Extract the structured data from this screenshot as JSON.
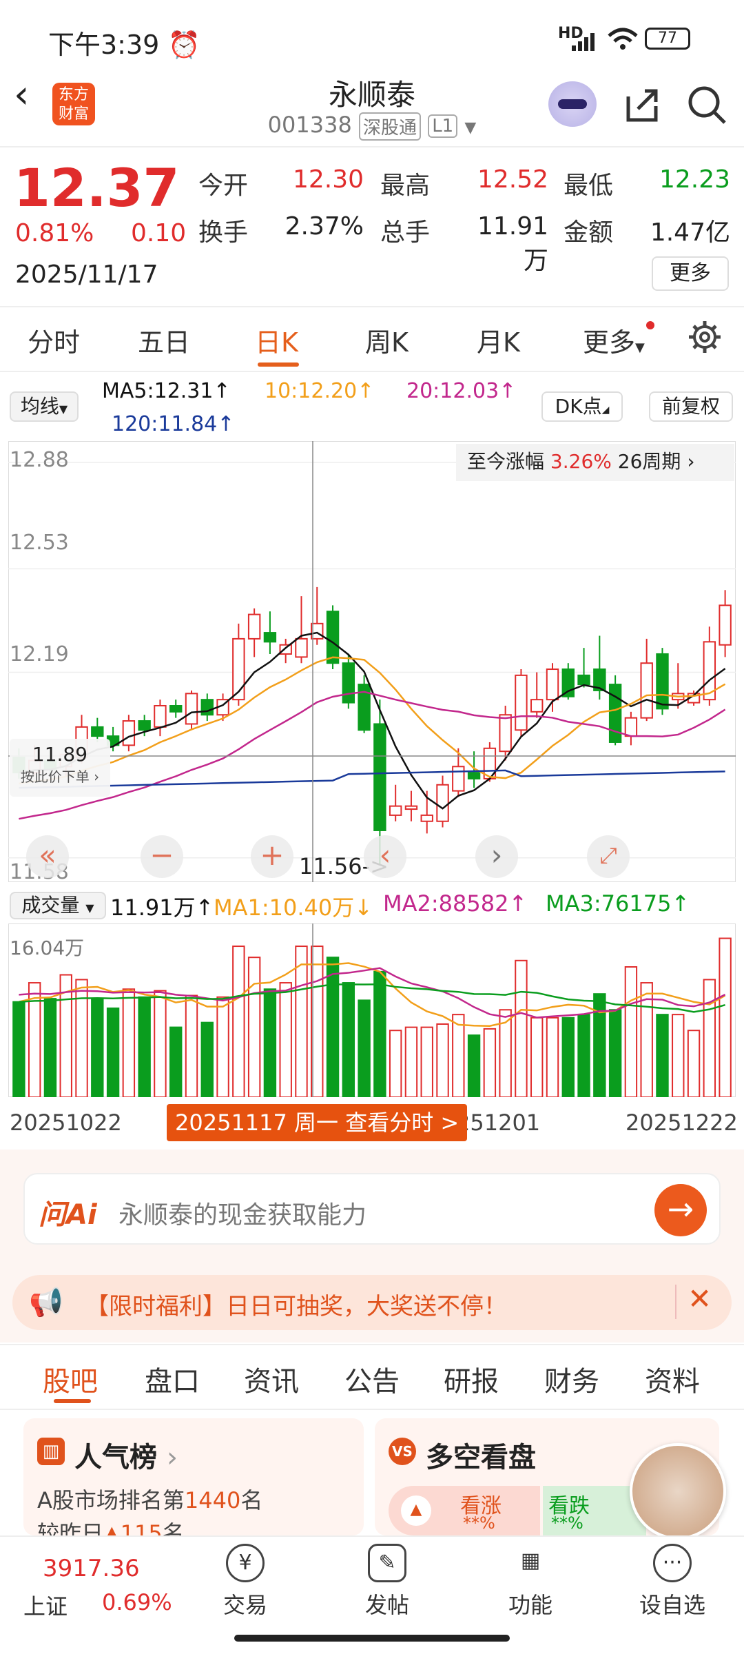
{
  "status_bar": {
    "time": "下午3:39",
    "network": "HD",
    "battery": "77"
  },
  "header": {
    "logo_line1": "东方",
    "logo_line2": "财富",
    "title": "永顺泰",
    "code": "001338",
    "market_badge": "深股通",
    "level_badge": "L1"
  },
  "quote": {
    "price": "12.37",
    "change_pct": "0.81%",
    "change": "0.10",
    "date": "2025/11/17",
    "open_label": "今开",
    "open": "12.30",
    "high_label": "最高",
    "high": "12.52",
    "low_label": "最低",
    "low": "12.23",
    "turnover_label": "换手",
    "turnover": "2.37%",
    "volume_label": "总手",
    "volume": "11.91万",
    "amount_label": "金额",
    "amount": "1.47亿",
    "more_label": "更多"
  },
  "tabs": [
    "分时",
    "五日",
    "日K",
    "周K",
    "月K",
    "更多",
    "settings"
  ],
  "ma_bar": {
    "selector": "均线",
    "ma5": "MA5:12.31↑",
    "ma10": "10:12.20↑",
    "ma20": "20:12.03↑",
    "ma120": "120:11.84↑",
    "dk_button": "DK点",
    "adjust_button": "前复权"
  },
  "chart_meta": {
    "yticks": [
      "12.88",
      "12.53",
      "12.19",
      "11.58"
    ],
    "since_label": "至今涨幅",
    "since_value": "3.26%",
    "period_label": "26周期",
    "cursor_price": "11.89",
    "cursor_hint": "按此价下单",
    "low_marker": "11.56->",
    "colors": {
      "up": "#e02c2c",
      "down": "#0a9d1e",
      "ma5": "#111111",
      "ma10": "#f29f1a",
      "ma20": "#c2278c",
      "ma120": "#1a3a9a"
    }
  },
  "volume_bar": {
    "selector": "成交量",
    "vol": "11.91万↑",
    "ma1": "MA1:10.40万↓",
    "ma2": "MA2:88582↑",
    "ma3": "MA3:76175↑",
    "ytick": "16.04万",
    "date_left": "20251022",
    "date_mid": "251201",
    "date_right": "20251222",
    "cursor_tag": "20251117 周一 查看分时 >"
  },
  "chart_data": {
    "type": "candlestick",
    "ylim": [
      11.5,
      12.95
    ],
    "candles": [
      {
        "o": 11.91,
        "h": 11.94,
        "l": 11.84,
        "c": 11.86,
        "v": 0.6
      },
      {
        "o": 11.86,
        "h": 11.95,
        "l": 11.85,
        "c": 11.9,
        "v": 0.72
      },
      {
        "o": 11.9,
        "h": 11.93,
        "l": 11.86,
        "c": 11.87,
        "v": 0.62
      },
      {
        "o": 11.88,
        "h": 11.94,
        "l": 11.85,
        "c": 11.92,
        "v": 0.77
      },
      {
        "o": 11.91,
        "h": 12.05,
        "l": 11.89,
        "c": 12.01,
        "v": 0.74
      },
      {
        "o": 12.01,
        "h": 12.04,
        "l": 11.96,
        "c": 11.98,
        "v": 0.62
      },
      {
        "o": 11.98,
        "h": 12.01,
        "l": 11.93,
        "c": 11.95,
        "v": 0.56
      },
      {
        "o": 11.95,
        "h": 12.05,
        "l": 11.93,
        "c": 12.03,
        "v": 0.68
      },
      {
        "o": 12.03,
        "h": 12.05,
        "l": 11.98,
        "c": 12.0,
        "v": 0.63
      },
      {
        "o": 12.01,
        "h": 12.1,
        "l": 11.98,
        "c": 12.08,
        "v": 0.67
      },
      {
        "o": 12.08,
        "h": 12.1,
        "l": 12.04,
        "c": 12.06,
        "v": 0.44
      },
      {
        "o": 12.02,
        "h": 12.13,
        "l": 12.0,
        "c": 12.12,
        "v": 0.64
      },
      {
        "o": 12.1,
        "h": 12.12,
        "l": 12.03,
        "c": 12.05,
        "v": 0.47
      },
      {
        "o": 12.05,
        "h": 12.12,
        "l": 12.03,
        "c": 12.1,
        "v": 0.63
      },
      {
        "o": 12.1,
        "h": 12.35,
        "l": 12.08,
        "c": 12.3,
        "v": 0.95
      },
      {
        "o": 12.3,
        "h": 12.4,
        "l": 12.24,
        "c": 12.38,
        "v": 0.88
      },
      {
        "o": 12.32,
        "h": 12.39,
        "l": 12.25,
        "c": 12.29,
        "v": 0.68
      },
      {
        "o": 12.25,
        "h": 12.3,
        "l": 12.22,
        "c": 12.28,
        "v": 0.72
      },
      {
        "o": 12.24,
        "h": 12.44,
        "l": 12.22,
        "c": 12.3,
        "v": 0.95
      },
      {
        "o": 12.3,
        "h": 12.47,
        "l": 12.28,
        "c": 12.35,
        "v": 0.95
      },
      {
        "o": 12.39,
        "h": 12.41,
        "l": 12.2,
        "c": 12.22,
        "v": 0.88
      },
      {
        "o": 12.22,
        "h": 12.25,
        "l": 12.07,
        "c": 12.09,
        "v": 0.72
      },
      {
        "o": 12.15,
        "h": 12.18,
        "l": 11.99,
        "c": 12.0,
        "v": 0.61
      },
      {
        "o": 12.02,
        "h": 12.1,
        "l": 11.56,
        "c": 11.67,
        "v": 0.79
      },
      {
        "o": 11.72,
        "h": 11.82,
        "l": 11.7,
        "c": 11.75,
        "v": 0.42
      },
      {
        "o": 11.74,
        "h": 11.8,
        "l": 11.7,
        "c": 11.75,
        "v": 0.44
      },
      {
        "o": 11.7,
        "h": 11.8,
        "l": 11.66,
        "c": 11.72,
        "v": 0.44
      },
      {
        "o": 11.7,
        "h": 11.85,
        "l": 11.68,
        "c": 11.82,
        "v": 0.46
      },
      {
        "o": 11.8,
        "h": 11.94,
        "l": 11.78,
        "c": 11.88,
        "v": 0.52
      },
      {
        "o": 11.86,
        "h": 11.93,
        "l": 11.81,
        "c": 11.84,
        "v": 0.39
      },
      {
        "o": 11.84,
        "h": 11.96,
        "l": 11.83,
        "c": 11.94,
        "v": 0.43
      },
      {
        "o": 11.93,
        "h": 12.08,
        "l": 11.9,
        "c": 12.05,
        "v": 0.55
      },
      {
        "o": 12.0,
        "h": 12.2,
        "l": 11.98,
        "c": 12.18,
        "v": 0.86
      },
      {
        "o": 12.06,
        "h": 12.19,
        "l": 12.04,
        "c": 12.1,
        "v": 0.5
      },
      {
        "o": 12.1,
        "h": 12.22,
        "l": 12.06,
        "c": 12.2,
        "v": 0.5
      },
      {
        "o": 12.2,
        "h": 12.22,
        "l": 12.1,
        "c": 12.11,
        "v": 0.5
      },
      {
        "o": 12.18,
        "h": 12.27,
        "l": 12.14,
        "c": 12.15,
        "v": 0.52
      },
      {
        "o": 12.2,
        "h": 12.31,
        "l": 12.1,
        "c": 12.13,
        "v": 0.65
      },
      {
        "o": 12.15,
        "h": 12.18,
        "l": 11.95,
        "c": 11.96,
        "v": 0.55
      },
      {
        "o": 11.98,
        "h": 12.06,
        "l": 11.95,
        "c": 12.04,
        "v": 0.82
      },
      {
        "o": 12.04,
        "h": 12.3,
        "l": 12.03,
        "c": 12.22,
        "v": 0.72
      },
      {
        "o": 12.25,
        "h": 12.27,
        "l": 12.05,
        "c": 12.07,
        "v": 0.52
      },
      {
        "o": 12.1,
        "h": 12.22,
        "l": 12.07,
        "c": 12.12,
        "v": 0.52
      },
      {
        "o": 12.09,
        "h": 12.13,
        "l": 12.08,
        "c": 12.12,
        "v": 0.42
      },
      {
        "o": 12.1,
        "h": 12.34,
        "l": 12.08,
        "c": 12.29,
        "v": 0.74
      },
      {
        "o": 12.28,
        "h": 12.46,
        "l": 12.24,
        "c": 12.41,
        "v": 1.0
      }
    ]
  }
}
